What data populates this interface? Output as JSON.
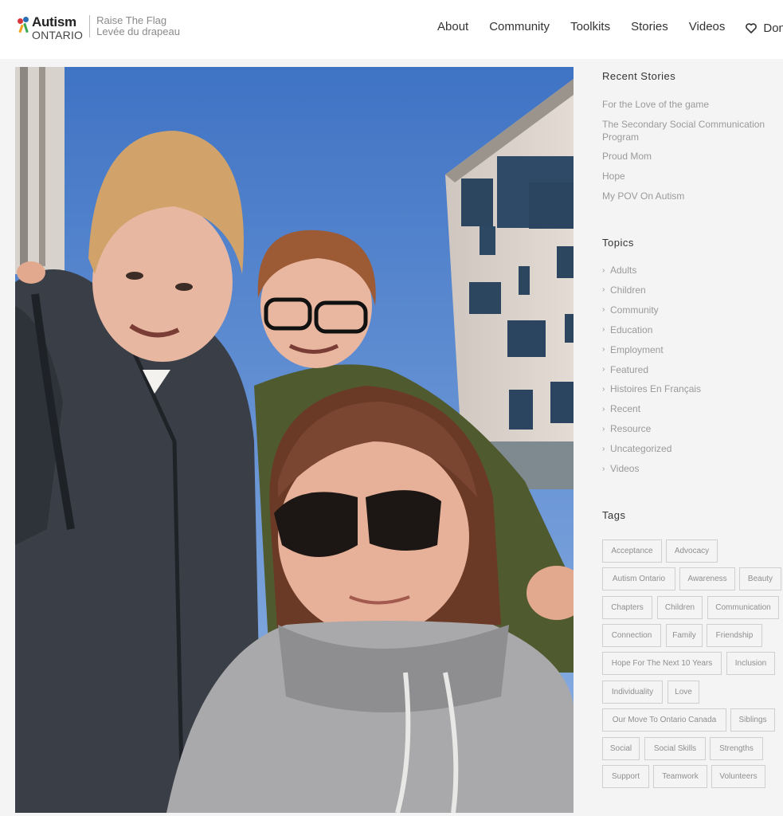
{
  "brand": {
    "name_line1": "Autism",
    "name_line2": "ONTARIO",
    "tagline_line1": "Raise The Flag",
    "tagline_line2": "Levée du drapeau"
  },
  "nav": {
    "items": [
      "About",
      "Community",
      "Toolkits",
      "Stories",
      "Videos"
    ],
    "donate_label": "Dona"
  },
  "photo": {
    "subject": "selfie of two boys and a woman with sunglasses outdoors"
  },
  "sidebar": {
    "recent_title": "Recent Stories",
    "recent_stories": [
      "For the Love of the game",
      "The Secondary Social Communication Program",
      "Proud Mom",
      "Hope",
      "My POV On Autism"
    ],
    "topics_title": "Topics",
    "topics": [
      "Adults",
      "Children",
      "Community",
      "Education",
      "Employment",
      "Featured",
      "Histoires En Français",
      "Recent",
      "Resource",
      "Uncategorized",
      "Videos"
    ],
    "tags_title": "Tags",
    "tags": [
      "Acceptance",
      "Advocacy",
      "Autism Ontario",
      "Awareness",
      "Beauty",
      "Chapters",
      "Children",
      "Communication",
      "Connection",
      "Family",
      "Friendship",
      "Hope For The Next 10 Years",
      "Inclusion",
      "Individuality",
      "Love",
      "Our Move To Ontario Canada",
      "Siblings",
      "Social",
      "Social Skills",
      "Strengths",
      "Support",
      "Teamwork",
      "Volunteers"
    ]
  },
  "colors": {
    "header_bg": "#ffffff",
    "page_bg": "#f4f4f4",
    "link_gray": "#9a9a9a",
    "tag_border": "#cfcfcf"
  }
}
